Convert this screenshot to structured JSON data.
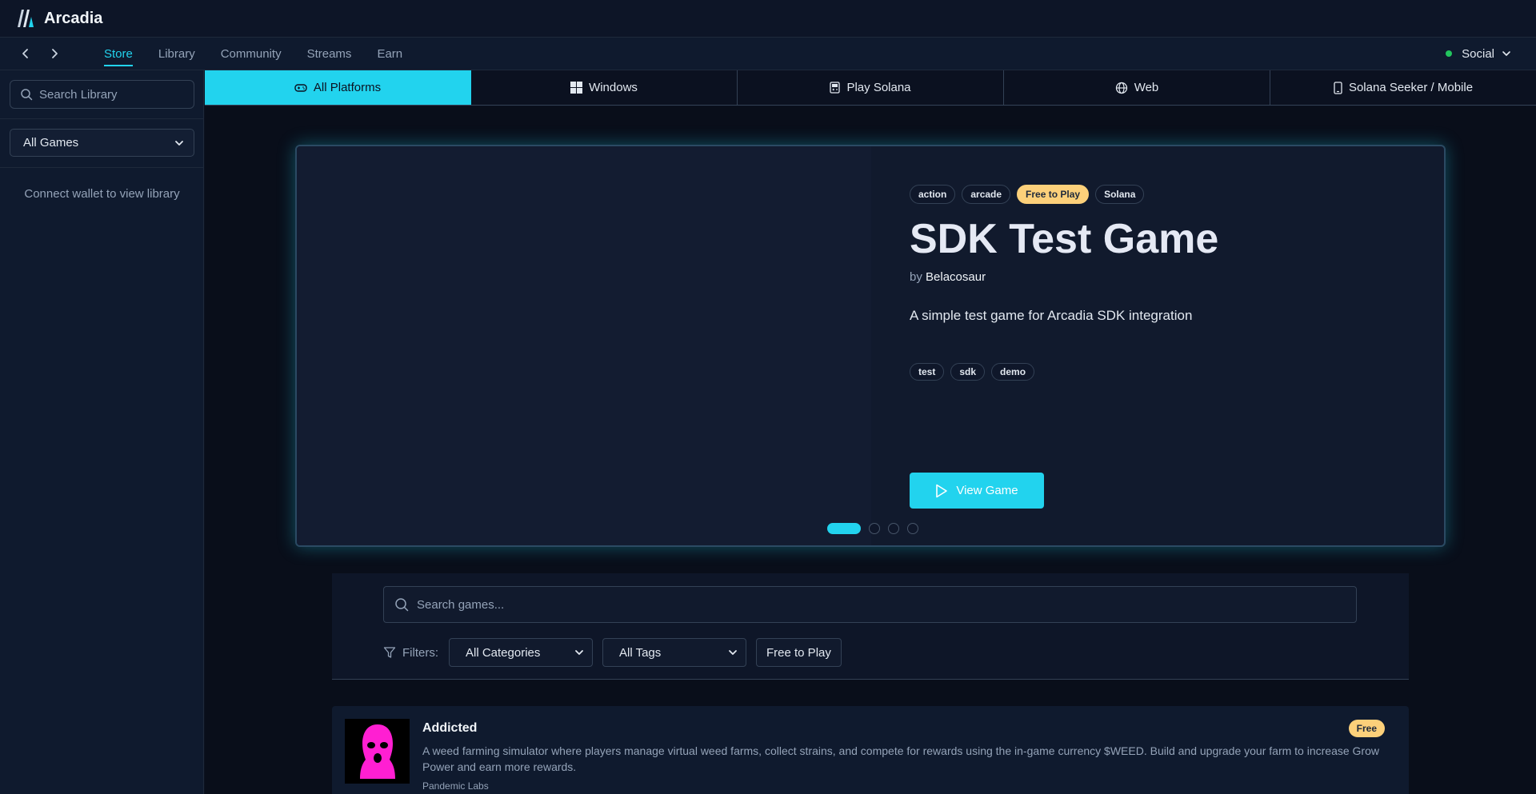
{
  "app": {
    "title": "Arcadia"
  },
  "nav": {
    "back_icon": "chevron-left-icon",
    "forward_icon": "chevron-right-icon",
    "tabs": [
      {
        "label": "Store",
        "active": true
      },
      {
        "label": "Library",
        "active": false
      },
      {
        "label": "Community",
        "active": false
      },
      {
        "label": "Streams",
        "active": false
      },
      {
        "label": "Earn",
        "active": false
      }
    ],
    "social_label": "Social",
    "social_status_color": "#22c55e"
  },
  "sidebar": {
    "search_placeholder": "Search Library",
    "filter_value": "All Games",
    "empty_text": "Connect wallet to view library"
  },
  "platforms": [
    {
      "label": "All Platforms",
      "icon": "gamepad-icon",
      "active": true
    },
    {
      "label": "Windows",
      "icon": "windows-icon",
      "active": false
    },
    {
      "label": "Play Solana",
      "icon": "handheld-icon",
      "active": false
    },
    {
      "label": "Web",
      "icon": "globe-icon",
      "active": false
    },
    {
      "label": "Solana Seeker / Mobile",
      "icon": "phone-icon",
      "active": false
    }
  ],
  "hero": {
    "tags": [
      "action",
      "arcade",
      "Free to Play",
      "Solana"
    ],
    "title": "SDK Test Game",
    "by_prefix": "by",
    "developer": "Belacosaur",
    "description": "A simple test game for Arcadia SDK integration",
    "subtags": [
      "test",
      "sdk",
      "demo"
    ],
    "button_label": "View Game",
    "slides_total": 4,
    "slide_active": 1
  },
  "filters": {
    "search_placeholder": "Search games...",
    "label": "Filters:",
    "category_value": "All Categories",
    "tags_value": "All Tags",
    "free_button": "Free to Play"
  },
  "games": [
    {
      "title": "Addicted",
      "description": "A weed farming simulator where players manage virtual weed farms, collect strains, and compete for rewards using the in-game currency $WEED. Build and upgrade your farm to increase Grow Power and earn more rewards.",
      "developer": "Pandemic Labs",
      "badge": "Free"
    }
  ],
  "colors": {
    "accent": "#22d3ee",
    "badge": "#fcd07a",
    "background": "#0b1120"
  }
}
